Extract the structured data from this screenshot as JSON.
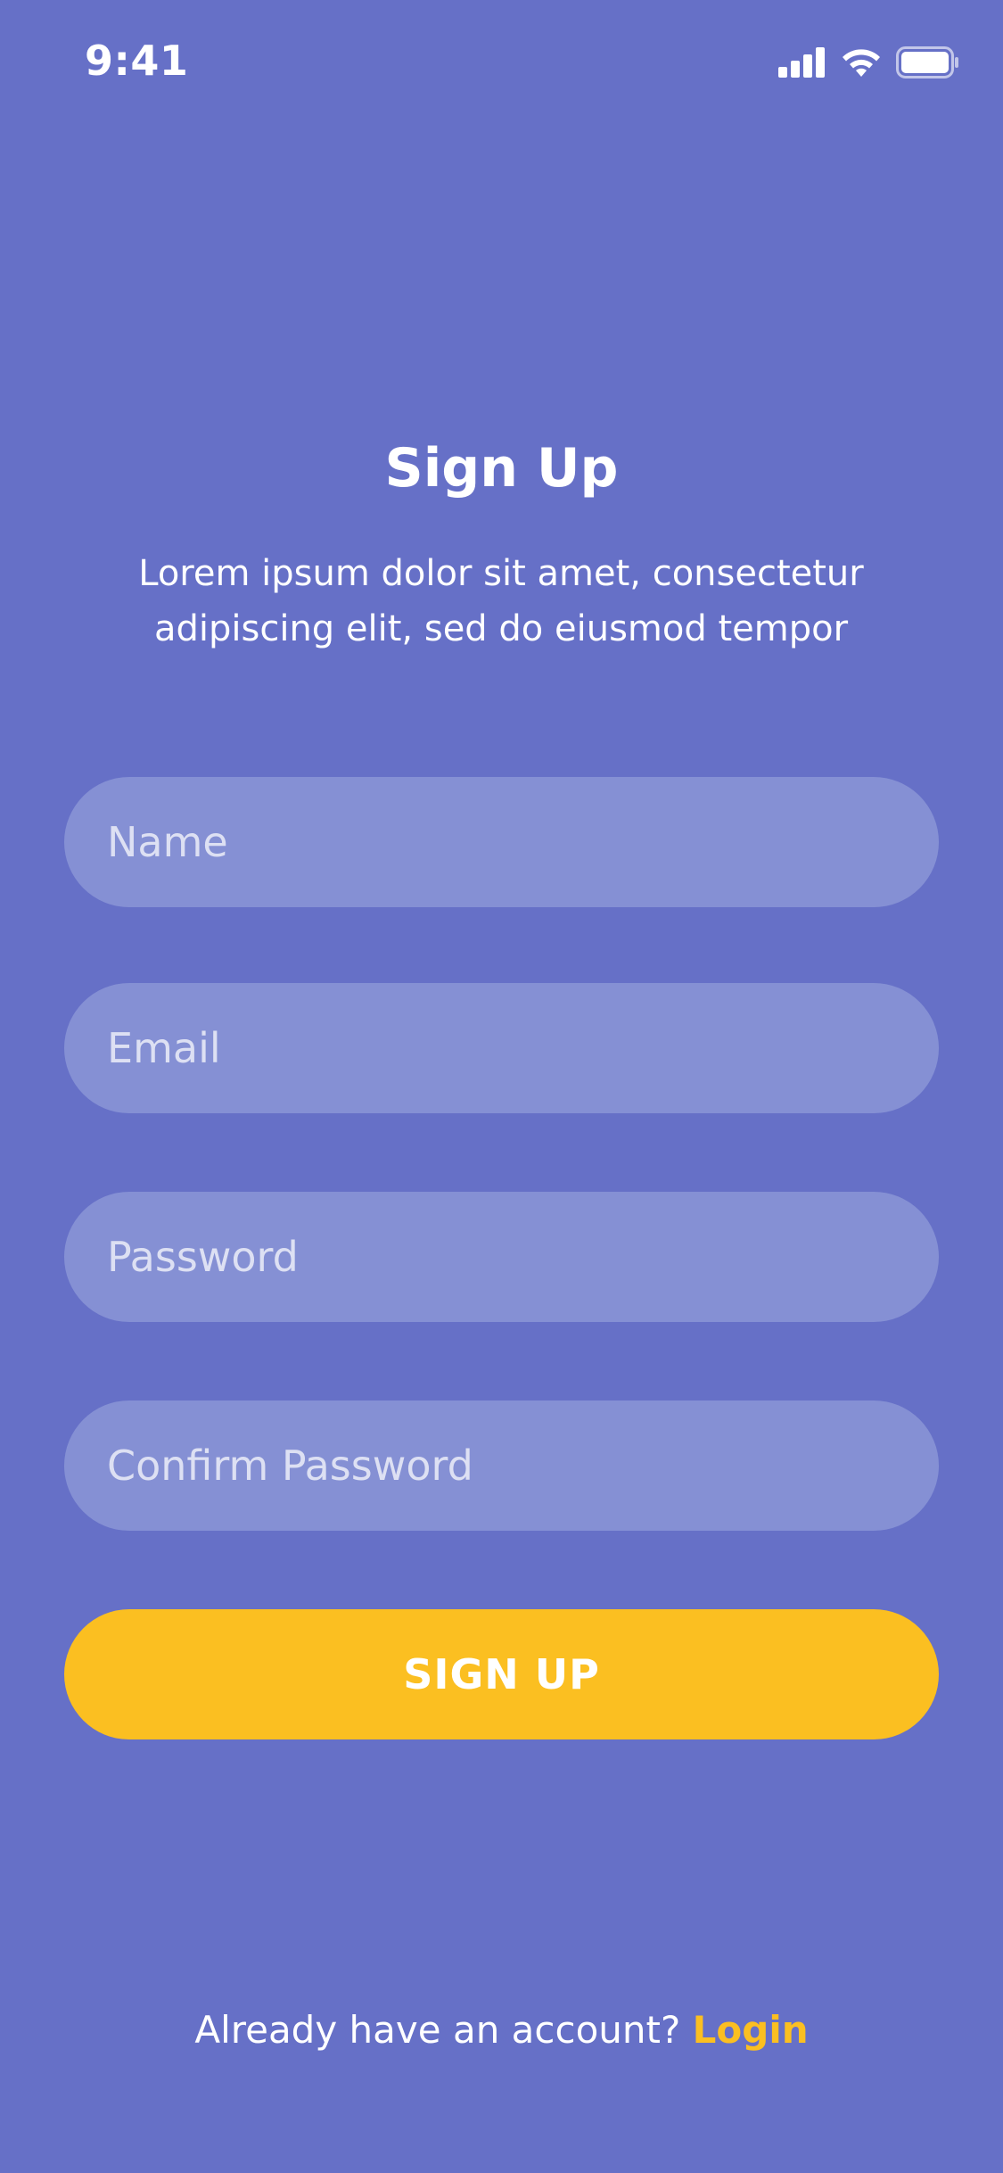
{
  "status_bar": {
    "time": "9:41"
  },
  "header": {
    "title": "Sign Up",
    "subtitle_line1": "Lorem ipsum dolor sit amet, consectetur",
    "subtitle_line2": "adipiscing elit, sed do eiusmod tempor"
  },
  "form": {
    "name_placeholder": "Name",
    "email_placeholder": "Email",
    "password_placeholder": "Password",
    "confirm_password_placeholder": "Confirm Password",
    "name_value": "",
    "email_value": "",
    "password_value": "",
    "confirm_password_value": ""
  },
  "actions": {
    "signup_label": "SIGN UP"
  },
  "footer": {
    "prompt": "Already have an account?",
    "login_label": "Login"
  },
  "colors": {
    "background": "#6670c7",
    "field_background": "#8590d4",
    "accent": "#fbbf21",
    "text": "#ffffff"
  },
  "icons": {
    "signal": "cellular-signal-icon",
    "wifi": "wifi-icon",
    "battery": "battery-icon"
  }
}
